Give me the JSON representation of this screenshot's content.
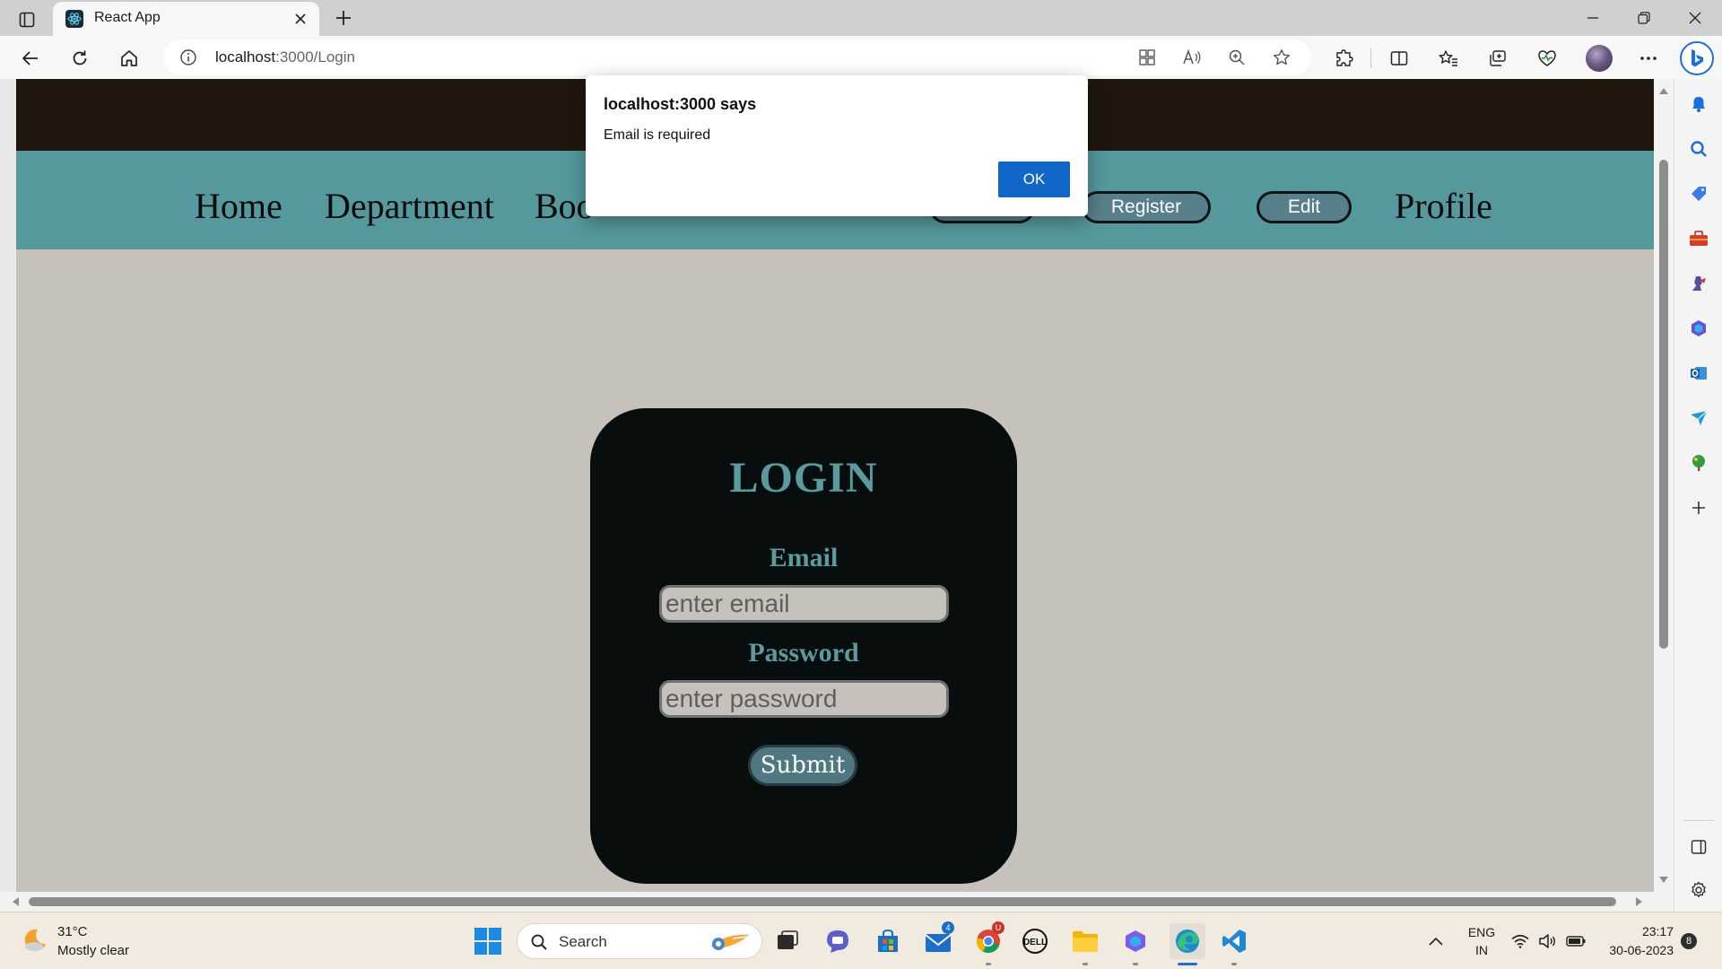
{
  "browser": {
    "tab_title": "React App",
    "url_host": "localhost",
    "url_path": ":3000/Login"
  },
  "page": {
    "nav_links": [
      "Home",
      "Department",
      "Boo",
      "Profile"
    ],
    "nav_buttons": [
      "Register",
      "Edit"
    ],
    "login": {
      "title": "LOGIN",
      "email_label": "Email",
      "email_placeholder": "enter email",
      "password_label": "Password",
      "password_placeholder": "enter password",
      "submit_label": "Submit"
    },
    "colors": {
      "top_bar": "#20160c",
      "navbar": "#55999c",
      "background": "#c6c1ba",
      "card": "#080e0e",
      "accent_text": "#5b9b9f"
    }
  },
  "dialog": {
    "title": "localhost:3000 says",
    "message": "Email is required",
    "ok_label": "OK"
  },
  "taskbar": {
    "weather_temp": "31°C",
    "weather_desc": "Mostly clear",
    "search_label": "Search",
    "mail_badge": "4",
    "chrome_badge": "U",
    "lang_line1": "ENG",
    "lang_line2": "IN",
    "time": "23:17",
    "date": "30-06-2023",
    "notification_count": "8"
  }
}
